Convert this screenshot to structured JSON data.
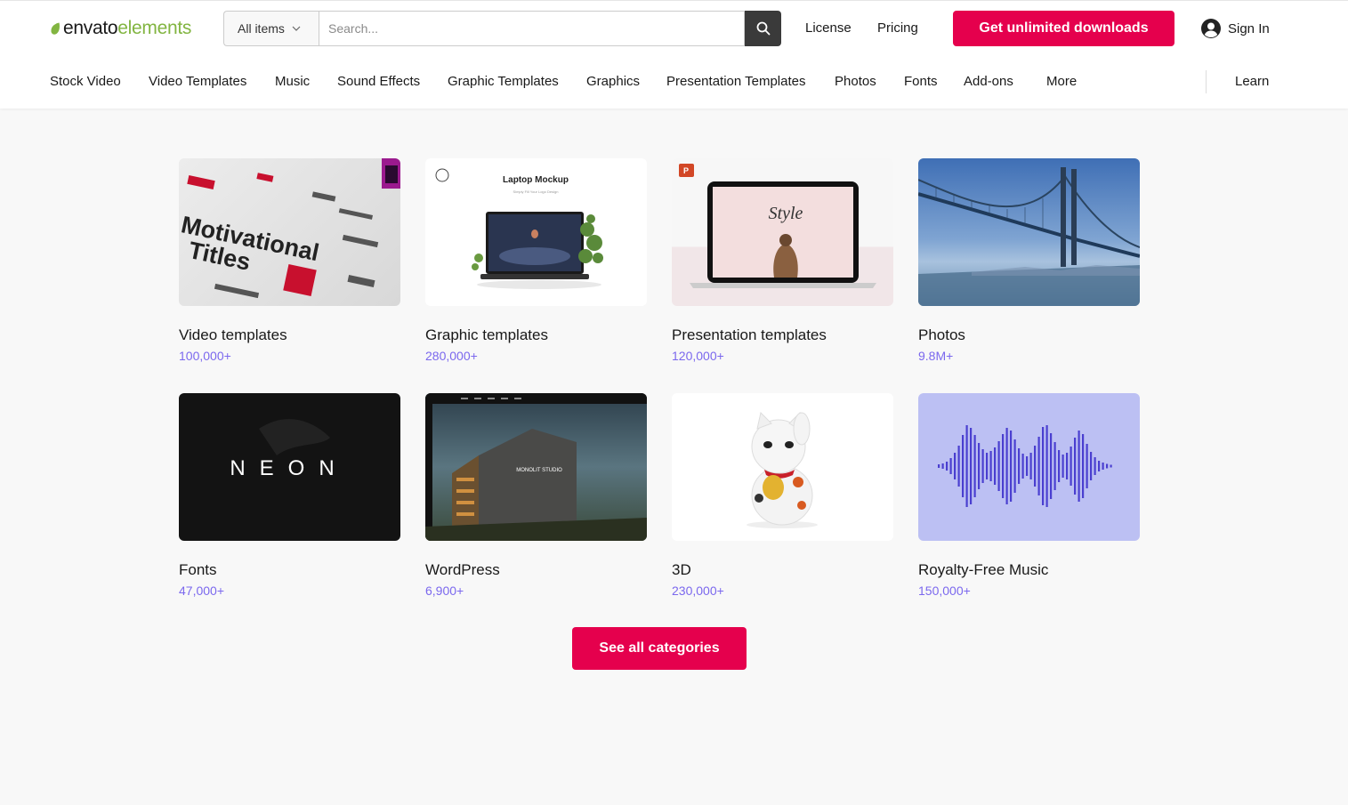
{
  "header": {
    "logo_part1": "envato",
    "logo_part2": "elements",
    "search_category": "All items",
    "search_placeholder": "Search...",
    "license": "License",
    "pricing": "Pricing",
    "cta": "Get unlimited downloads",
    "signin": "Sign In"
  },
  "nav": {
    "items": [
      "Stock Video",
      "Video Templates",
      "Music",
      "Sound Effects",
      "Graphic Templates",
      "Graphics",
      "Presentation Templates",
      "Photos",
      "Fonts",
      "Add-ons",
      "More"
    ],
    "learn": "Learn"
  },
  "categories": [
    {
      "title": "Video templates",
      "count": "100,000+"
    },
    {
      "title": "Graphic templates",
      "count": "280,000+"
    },
    {
      "title": "Presentation templates",
      "count": "120,000+"
    },
    {
      "title": "Photos",
      "count": "9.8M+"
    },
    {
      "title": "Fonts",
      "count": "47,000+"
    },
    {
      "title": "WordPress",
      "count": "6,900+"
    },
    {
      "title": "3D",
      "count": "230,000+"
    },
    {
      "title": "Royalty-Free Music",
      "count": "150,000+"
    }
  ],
  "thumbs": {
    "video_text1": "Motivational",
    "video_text2": "Titles",
    "graphic_title": "Laptop Mockup",
    "graphic_sub": "Simply Fill Your Logo Design",
    "presentation_word": "Style",
    "fonts_word": "NEON",
    "wp_studio": "MONOLIT STUDIO"
  },
  "see_all": "See all categories",
  "colors": {
    "accent": "#e5004d",
    "brand_green": "#82b541",
    "count_purple": "#7b68ee"
  }
}
